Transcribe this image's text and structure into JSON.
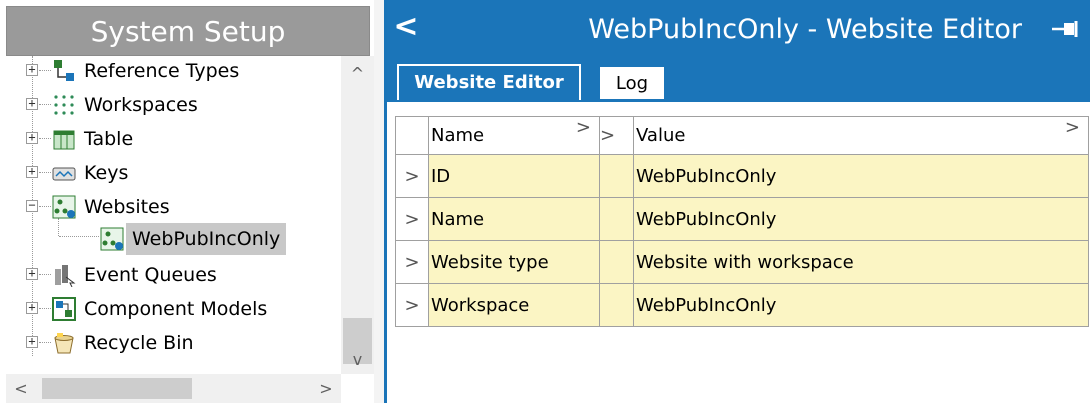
{
  "left_pane": {
    "title": "System Setup",
    "tree": [
      {
        "label": "Reference Types",
        "icon": "reference-types-icon",
        "expander": "+"
      },
      {
        "label": "Workspaces",
        "icon": "workspaces-icon",
        "expander": "+"
      },
      {
        "label": "Table",
        "icon": "table-icon",
        "expander": "+"
      },
      {
        "label": "Keys",
        "icon": "keys-icon",
        "expander": "+"
      },
      {
        "label": "Websites",
        "icon": "websites-icon",
        "expander": "−"
      },
      {
        "label": "WebPubIncOnly",
        "icon": "website-icon",
        "selected": true
      },
      {
        "label": "Event Queues",
        "icon": "event-queues-icon",
        "expander": "+"
      },
      {
        "label": "Component Models",
        "icon": "component-models-icon",
        "expander": "+"
      },
      {
        "label": "Recycle Bin",
        "icon": "recycle-bin-icon",
        "expander": "+"
      }
    ],
    "scroll_up": "^",
    "scroll_down": "v",
    "scroll_left": "<",
    "scroll_right": ">"
  },
  "editor": {
    "back_glyph": "<",
    "title": "WebPubIncOnly - Website Editor",
    "tabs": [
      {
        "label": "Website Editor",
        "active": true
      },
      {
        "label": "Log",
        "active": false
      }
    ],
    "grid": {
      "columns": {
        "name": "Name",
        "value": "Value",
        "chevron": ">"
      },
      "rows": [
        {
          "arrow": ">",
          "name": "ID",
          "value": "WebPubIncOnly"
        },
        {
          "arrow": ">",
          "name": "Name",
          "value": "WebPubIncOnly"
        },
        {
          "arrow": ">",
          "name": "Website type",
          "value": "Website with workspace"
        },
        {
          "arrow": ">",
          "name": "Workspace",
          "value": "WebPubIncOnly"
        }
      ]
    }
  },
  "colors": {
    "accent": "#1b75b9",
    "title_gray": "#9a9a9a",
    "row_highlight": "#fbf5c4",
    "selected_item": "#c8c8c8"
  }
}
